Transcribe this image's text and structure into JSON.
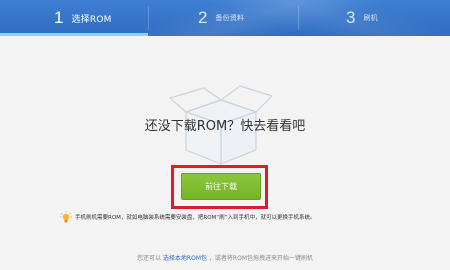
{
  "steps": [
    {
      "number": "1",
      "label": "选择ROM",
      "state": "active"
    },
    {
      "number": "2",
      "label": "备份资料",
      "state": "inactive"
    },
    {
      "number": "3",
      "label": "刷机",
      "state": "inactive"
    }
  ],
  "main": {
    "heading": "还没下载ROM？快去看看吧",
    "download_button": "前往下载",
    "illustration_icon": "empty-box-icon"
  },
  "tip": {
    "icon": "lightbulb-icon",
    "text": "手机刷机需要ROM，就如电脑装系统需要安装盘，把ROM“刷”入到手机中，就可以更换手机系统。"
  },
  "bottom": {
    "prefix": "您还可以",
    "link": "选择本地ROM包",
    "suffix": "，或者将ROM包拖拽进来开始一键刷机"
  },
  "colors": {
    "header": "#3a78cf",
    "active_underline": "#7fd8ff",
    "button": "#7ebd31",
    "highlight_frame": "#d81f27",
    "link": "#2d6fd0"
  }
}
